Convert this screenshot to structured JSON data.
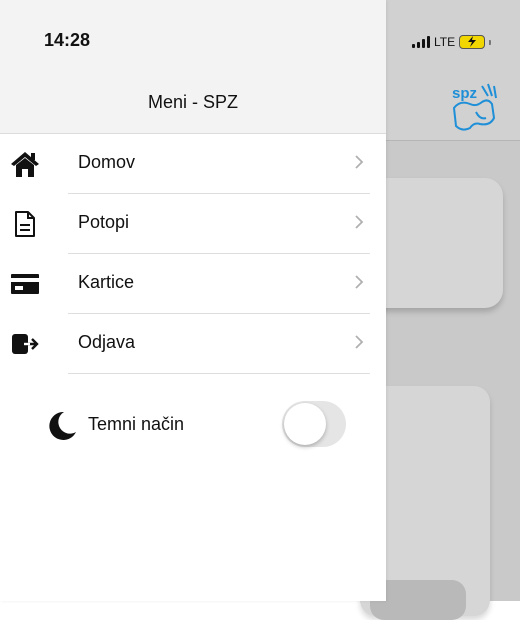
{
  "status_bar": {
    "time": "14:28",
    "network": "LTE"
  },
  "drawer": {
    "title": "Meni - SPZ",
    "items": [
      {
        "label": "Domov",
        "icon": "home-icon"
      },
      {
        "label": "Potopi",
        "icon": "document-icon"
      },
      {
        "label": "Kartice",
        "icon": "card-icon"
      },
      {
        "label": "Odjava",
        "icon": "logout-icon"
      }
    ],
    "dark_mode": {
      "label": "Temni način",
      "icon": "moon-icon",
      "enabled": false
    }
  },
  "background_app": {
    "logo_text": "spz"
  },
  "colors": {
    "drawer_bg": "#ffffff",
    "header_bg": "#f3f3f3",
    "backdrop": "#c9c9c9",
    "logo_blue": "#1f8fd8",
    "battery": "#f2d600"
  }
}
